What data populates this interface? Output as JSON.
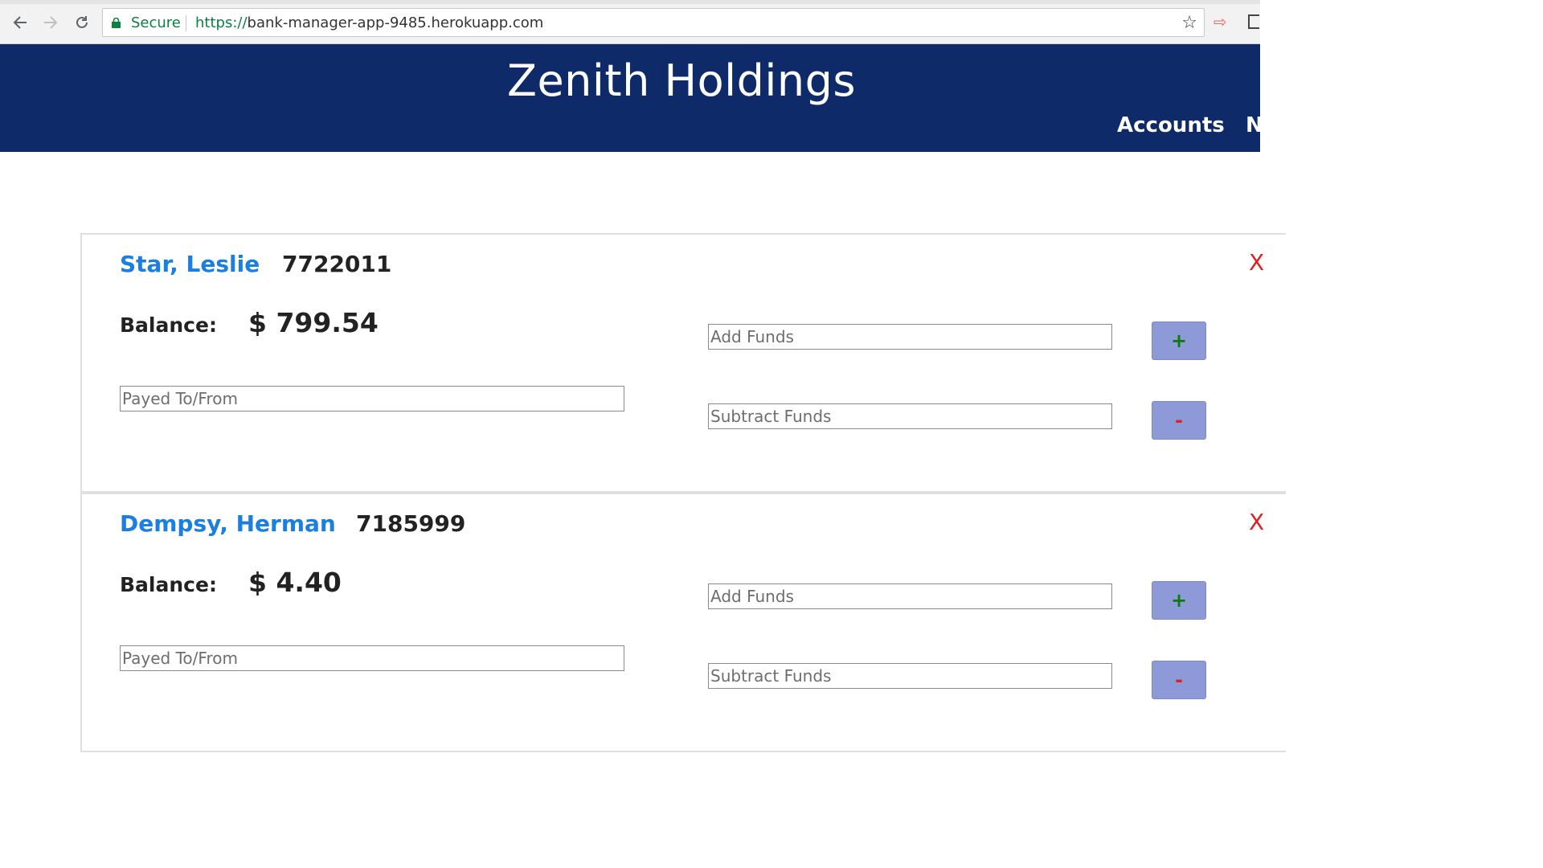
{
  "browser": {
    "secure_label": "Secure",
    "url_scheme": "https://",
    "url_host": "bank-manager-app-9485.herokuapp.com",
    "back_icon": "arrow-left-icon",
    "forward_icon": "arrow-right-icon",
    "reload_icon": "reload-icon",
    "star_icon": "star-icon"
  },
  "header": {
    "brand": "Zenith Holdings",
    "nav": [
      "Accounts",
      "N"
    ],
    "background_color": "#0e2a68"
  },
  "accounts": [
    {
      "name": "Star, Leslie",
      "number": "7722011",
      "balance_label": "Balance:",
      "balance": "$ 799.54",
      "payee_placeholder": "Payed To/From",
      "add_placeholder": "Add Funds",
      "subtract_placeholder": "Subtract Funds",
      "add_button": "+",
      "subtract_button": "-",
      "delete_label": "X"
    },
    {
      "name": "Dempsy, Herman",
      "number": "7185999",
      "balance_label": "Balance:",
      "balance": "$ 4.40",
      "payee_placeholder": "Payed To/From",
      "add_placeholder": "Add Funds",
      "subtract_placeholder": "Subtract Funds",
      "add_button": "+",
      "subtract_button": "-",
      "delete_label": "X"
    }
  ],
  "colors": {
    "name_link": "#1a7fe0",
    "delete": "#e02020",
    "button_bg": "#8e9ad8",
    "plus": "#0a7a0a",
    "minus": "#e02020"
  }
}
